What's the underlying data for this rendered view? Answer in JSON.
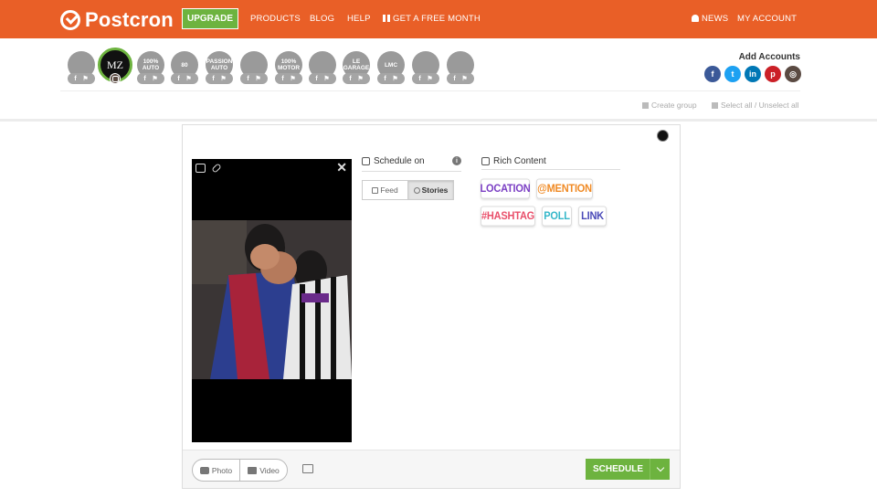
{
  "brand": {
    "name": "Postcron",
    "accent": "#e95f27",
    "green": "#6db33f"
  },
  "nav": {
    "upgrade": "UPGRADE",
    "products": "PRODUCTS",
    "blog": "BLOG",
    "help": "HELP",
    "free_month": "GET A FREE MONTH",
    "news": "NEWS",
    "my_account": "MY ACCOUNT"
  },
  "accounts": {
    "items": [
      {
        "label": "",
        "badge": "f"
      },
      {
        "label": "MZ",
        "badge": "ig",
        "selected": true
      },
      {
        "label": "100% AUTO",
        "badge": "f"
      },
      {
        "label": "80",
        "badge": "f"
      },
      {
        "label": "PASSION AUTO",
        "badge": "f"
      },
      {
        "label": "",
        "badge": "f"
      },
      {
        "label": "100% MOTOR",
        "badge": "f"
      },
      {
        "label": "",
        "badge": "f"
      },
      {
        "label": "LE GARAGE",
        "badge": "f"
      },
      {
        "label": "LMC",
        "badge": "f"
      },
      {
        "label": "",
        "badge": "f"
      },
      {
        "label": "",
        "badge": "f"
      }
    ],
    "badge_text": "f",
    "add_label": "Add Accounts",
    "networks": [
      {
        "name": "facebook",
        "glyph": "f",
        "color": "#3b5998"
      },
      {
        "name": "twitter",
        "glyph": "t",
        "color": "#1da1f2"
      },
      {
        "name": "linkedin",
        "glyph": "in",
        "color": "#0077b5"
      },
      {
        "name": "pinterest",
        "glyph": "p",
        "color": "#cb2027"
      },
      {
        "name": "instagram",
        "glyph": "◎",
        "color": "#5a4a42"
      }
    ],
    "create_group": "Create group",
    "select_all": "Select all / Unselect all"
  },
  "composer": {
    "schedule_on": "Schedule on",
    "feed": "Feed",
    "stories": "Stories",
    "rich_content": "Rich Content",
    "chips": [
      {
        "label": "LOCATION",
        "color": "#7b3fc4"
      },
      {
        "label": "@MENTION",
        "color": "#f08a24"
      },
      {
        "label": "#HASHTAG",
        "color": "#e9506b"
      },
      {
        "label": "POLL",
        "color": "#35b7c9"
      },
      {
        "label": "LINK",
        "color": "#4a4ab8"
      }
    ],
    "photo": "Photo",
    "video": "Video",
    "schedule": "SCHEDULE"
  }
}
